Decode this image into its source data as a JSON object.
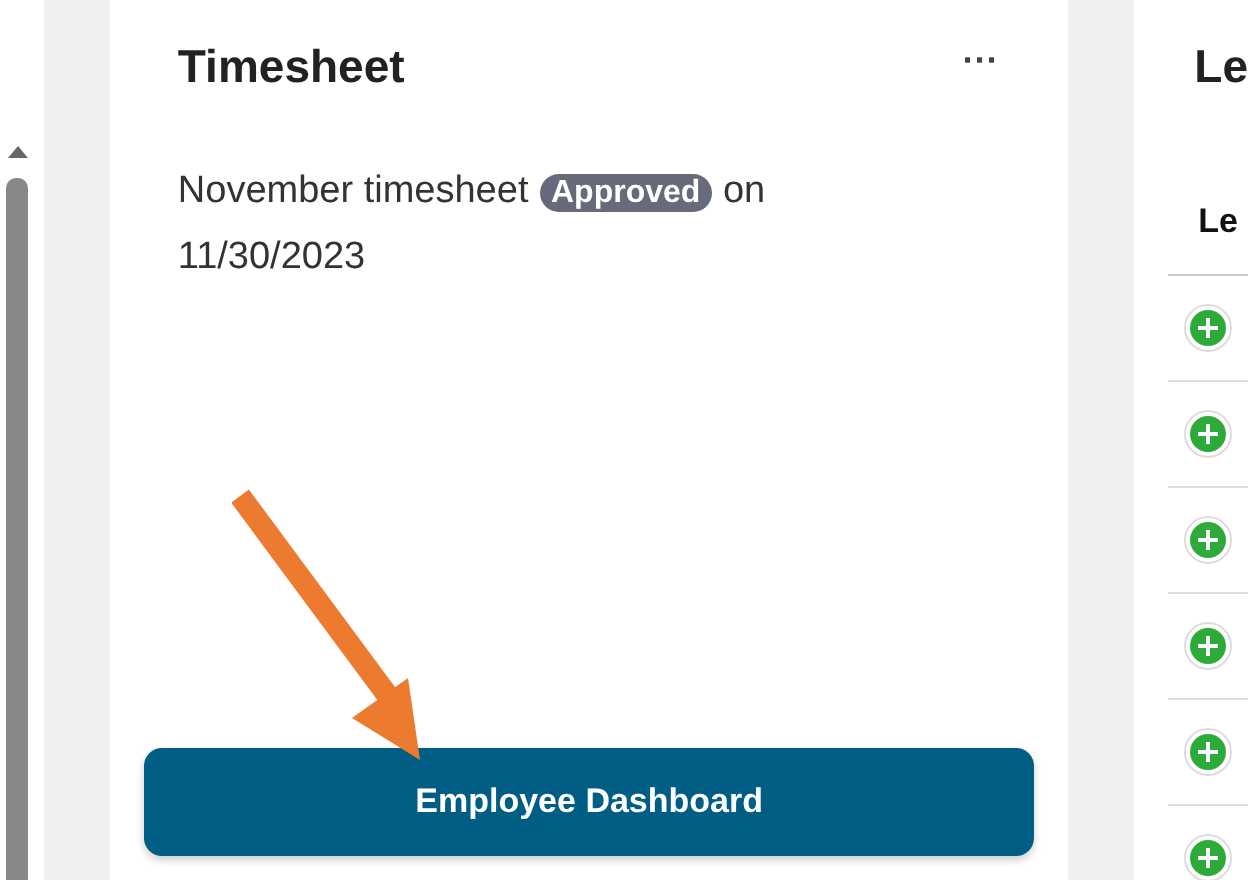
{
  "timesheet_card": {
    "title": "Timesheet",
    "menu": "···",
    "message_before": "November timesheet",
    "status": "Approved",
    "message_after": "on",
    "date": "11/30/2023",
    "button": "Employee Dashboard"
  },
  "second_card": {
    "title": "Le",
    "column_header": "Le",
    "rows": [
      {
        "kind": "add"
      },
      {
        "kind": "add"
      },
      {
        "kind": "add"
      },
      {
        "kind": "add"
      },
      {
        "kind": "add"
      },
      {
        "kind": "add"
      }
    ]
  }
}
